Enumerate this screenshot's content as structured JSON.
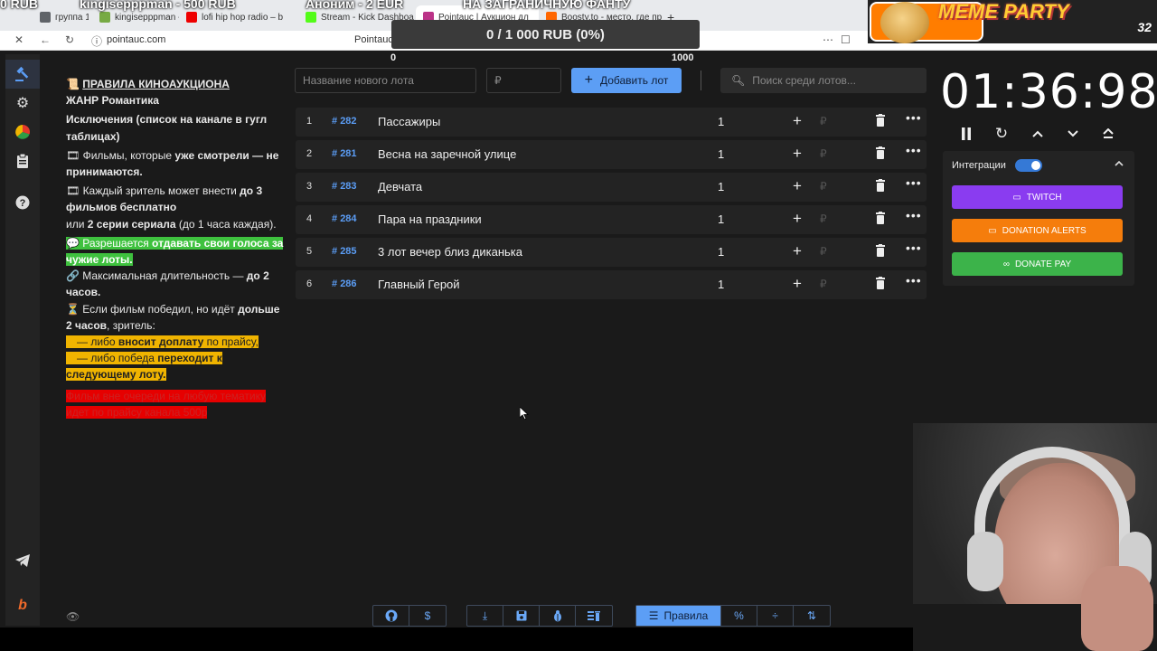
{
  "browser": {
    "tabs": [
      {
        "label": "группа 1",
        "active": false
      },
      {
        "label": "kingisepppman - 500 RUB",
        "active": false
      },
      {
        "label": "lofi hip hop radio – b",
        "active": false
      },
      {
        "label": "Stream - Kick Dashboard",
        "active": false
      },
      {
        "label": "Pointauc | Аукцион дл",
        "active": true
      },
      {
        "label": "Boosty.to - место, где пр",
        "active": false
      }
    ],
    "overlay_texts": [
      "0 RUB",
      "kingisepppman - 500 RUB",
      "Аноним - 2 EUR",
      "НА ЗАГРАНИЧНУЮ ФАНТУ"
    ],
    "url": "pointauc.com",
    "page_title": "Pointauc"
  },
  "overlay": {
    "brand": "MEME PARTY",
    "counter": "32"
  },
  "progress": {
    "label": "0 / 1 000 RUB (0%)",
    "scale_min": "0",
    "scale_max": "1000",
    "fraction": 0
  },
  "sidebar_icons": [
    "auction-icon",
    "gear-icon",
    "pie-chart-icon",
    "clipboard-icon",
    "help-icon",
    "telegram-icon",
    "boosty-icon"
  ],
  "rules": {
    "title": "ПРАВИЛА КИНОАУКЦИОНА",
    "genre": "ЖАНР Романтика",
    "exceptions": "Исключения (список на канале в гугл таблицах)",
    "r1_pre": "🎞 Фильмы, которые ",
    "r1_bold": "уже смотрели — не принимаются.",
    "r2_pre": "🎞 Каждый зритель может внести ",
    "r2_bold": "до 3 фильмов бесплатно",
    "r2_mid": "или ",
    "r2_bold2": "2 серии сериала",
    "r2_post": " (до 1 часа каждая).",
    "r3_pre": "💬 Разрешается ",
    "r3_bold": "отдавать свои голоса за чужие лоты.",
    "r4_pre": "🔗 Максимальная длительность — ",
    "r4_bold": "до 2 часов.",
    "r5_pre": "⏳ Если фильм победил, но идёт ",
    "r5_bold": "дольше 2 часов",
    "r5_post": ", зритель:",
    "r6_pre": "— либо ",
    "r6_bold": "вносит доплату",
    "r6_post": " по прайсу,",
    "r7_pre": "— либо победа ",
    "r7_bold": "переходит к следующему лоту.",
    "r8": "Фильм вне очереди на любую тематику идет по прайсу канала 500р"
  },
  "add_lot": {
    "name_placeholder": "Название нового лота",
    "amount_placeholder": "₽",
    "button": "Добавить лот",
    "search_placeholder": "Поиск среди лотов..."
  },
  "lots": [
    {
      "n": "1",
      "id": "282",
      "name": "Пассажиры",
      "amount": "1"
    },
    {
      "n": "2",
      "id": "281",
      "name": "Весна на заречной улице",
      "amount": "1"
    },
    {
      "n": "3",
      "id": "283",
      "name": "Девчата",
      "amount": "1"
    },
    {
      "n": "4",
      "id": "284",
      "name": "Пара на праздники",
      "amount": "1"
    },
    {
      "n": "5",
      "id": "285",
      "name": " 3 лот вечер близ диканька",
      "amount": "1"
    },
    {
      "n": "6",
      "id": "286",
      "name": "Главный Герой",
      "amount": "1"
    }
  ],
  "timer": {
    "value": "01:36:98"
  },
  "integrations": {
    "label": "Интеграции",
    "enabled": true,
    "buttons": [
      {
        "label": "TWITCH",
        "color": "#8a3cf0"
      },
      {
        "label": "DONATION ALERTS",
        "color": "#f57d0c"
      },
      {
        "label": "DONATE PAY",
        "color": "#3cb34a"
      }
    ]
  },
  "toolbar": {
    "rules_label": "Правила"
  }
}
